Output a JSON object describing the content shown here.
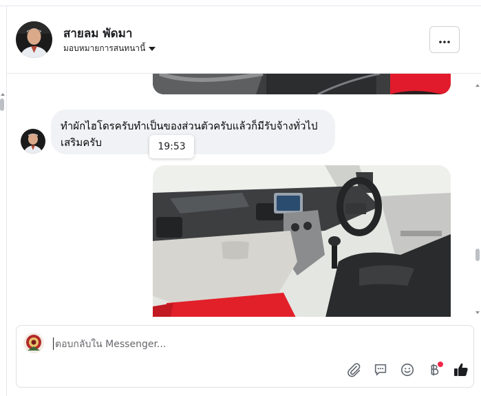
{
  "header": {
    "name": "สายลม พัดมา",
    "assign_label": "มอบหมายการสนทนานี้"
  },
  "messages": {
    "text": "ทำผักไฮโดรครับทำเป็นของส่วนตัวครับแล้วก็มีรับจ้างทั่วไปเสริมครับ",
    "tooltip_time": "19:53"
  },
  "composer": {
    "placeholder": "ตอบกลับใน Messenger..."
  },
  "icons": {
    "more": "more-options-icon",
    "dropdown": "caret-down-icon",
    "attach": "paperclip-icon",
    "saved_replies": "chat-bubble-icon",
    "emoji": "smiley-icon",
    "payment": "baht-icon",
    "like": "thumbs-up-icon"
  },
  "colors": {
    "bubble": "#f0f2f5",
    "notification_dot": "#f02849",
    "icon_gray": "#606770"
  }
}
